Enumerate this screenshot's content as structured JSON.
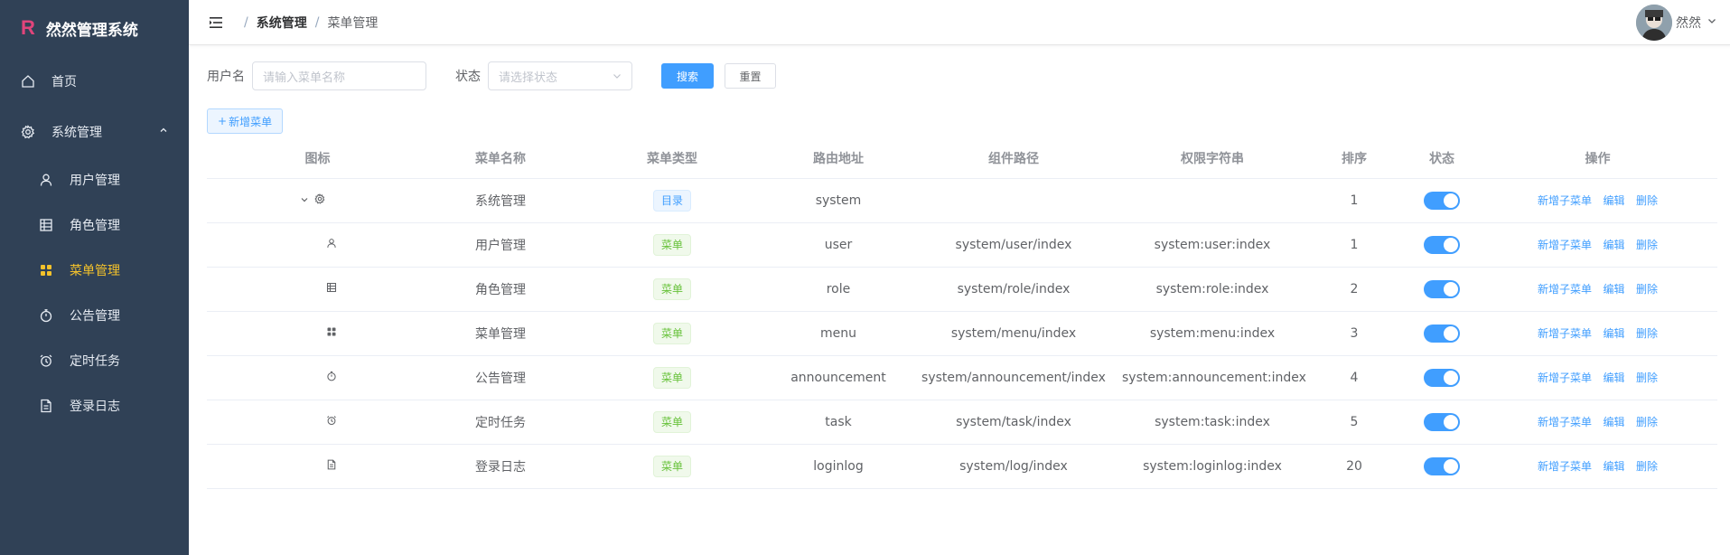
{
  "brand": {
    "logo": "R",
    "title": "然然管理系统"
  },
  "sidebar": {
    "home": {
      "label": "首页",
      "icon": "home-icon"
    },
    "system": {
      "label": "系统管理",
      "icon": "gear-icon",
      "expanded": true
    },
    "items": [
      {
        "label": "用户管理",
        "icon": "user-icon",
        "active": false
      },
      {
        "label": "角色管理",
        "icon": "grid-icon",
        "active": false
      },
      {
        "label": "菜单管理",
        "icon": "menu-squares-icon",
        "active": true
      },
      {
        "label": "公告管理",
        "icon": "stopwatch-icon",
        "active": false
      },
      {
        "label": "定时任务",
        "icon": "alarm-icon",
        "active": false
      },
      {
        "label": "登录日志",
        "icon": "document-icon",
        "active": false
      }
    ]
  },
  "header": {
    "breadcrumb": [
      "系统管理",
      "菜单管理"
    ],
    "user_name": "然然"
  },
  "search": {
    "name_label": "用户名",
    "name_placeholder": "请输入菜单名称",
    "status_label": "状态",
    "status_placeholder": "请选择状态",
    "search_button": "搜索",
    "reset_button": "重置"
  },
  "toolbar": {
    "add_button": "新增菜单"
  },
  "table": {
    "columns": [
      "图标",
      "菜单名称",
      "菜单类型",
      "路由地址",
      "组件路径",
      "权限字符串",
      "排序",
      "状态",
      "操作"
    ],
    "actions": {
      "add_child": "新增子菜单",
      "edit": "编辑",
      "delete": "删除"
    },
    "rows": [
      {
        "icon": "gear-icon",
        "name": "系统管理",
        "type": "目录",
        "route": "system",
        "component": "",
        "perm": "",
        "order": "1",
        "enabled": true,
        "expandable": true
      },
      {
        "icon": "user-icon",
        "name": "用户管理",
        "type": "菜单",
        "route": "user",
        "component": "system/user/index",
        "perm": "system:user:index",
        "order": "1",
        "enabled": true
      },
      {
        "icon": "grid-icon",
        "name": "角色管理",
        "type": "菜单",
        "route": "role",
        "component": "system/role/index",
        "perm": "system:role:index",
        "order": "2",
        "enabled": true
      },
      {
        "icon": "menu-squares-icon",
        "name": "菜单管理",
        "type": "菜单",
        "route": "menu",
        "component": "system/menu/index",
        "perm": "system:menu:index",
        "order": "3",
        "enabled": true
      },
      {
        "icon": "stopwatch-icon",
        "name": "公告管理",
        "type": "菜单",
        "route": "announcement",
        "component": "system/announcement/index",
        "perm": "system:announcement:index",
        "order": "4",
        "enabled": true
      },
      {
        "icon": "alarm-icon",
        "name": "定时任务",
        "type": "菜单",
        "route": "task",
        "component": "system/task/index",
        "perm": "system:task:index",
        "order": "5",
        "enabled": true
      },
      {
        "icon": "document-icon",
        "name": "登录日志",
        "type": "菜单",
        "route": "loginlog",
        "component": "system/log/index",
        "perm": "system:loginlog:index",
        "order": "20",
        "enabled": true
      }
    ]
  },
  "colors": {
    "sidebar_bg": "#304156",
    "primary": "#409eff",
    "active_menu": "#f4c22b",
    "brand_logo": "#e0457b"
  }
}
